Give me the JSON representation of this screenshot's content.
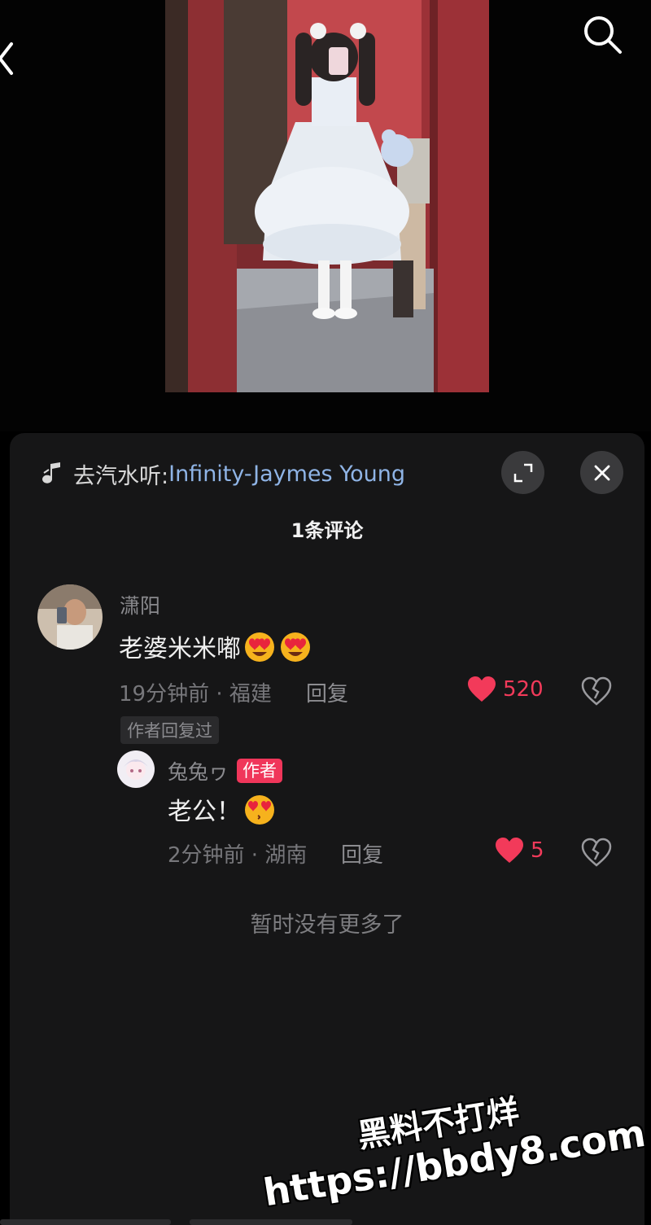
{
  "nav": {
    "back_icon": "chevron-left-icon",
    "search_icon": "search-icon"
  },
  "sheet": {
    "music": {
      "icon": "music-note-icon",
      "prefix": "去汽水听: ",
      "song": "Infinity-Jaymes Young"
    },
    "expand_icon": "expand-icon",
    "close_icon": "close-icon",
    "comment_count": "1条评论",
    "comments": [
      {
        "username": "潇阳",
        "text": "老婆米米嘟",
        "emojis": [
          "heart-eyes-emoji",
          "heart-eyes-emoji"
        ],
        "time_location": "19分钟前 · 福建",
        "reply_label": "回复",
        "likes": "520",
        "author_replied_tag": "作者回复过"
      }
    ],
    "replies": [
      {
        "username": "兔兔ヮ",
        "badge": "作者",
        "text": "老公！",
        "emojis": [
          "kiss-heart-emoji"
        ],
        "time_location": "2分钟前 · 湖南",
        "reply_label": "回复",
        "likes": "5"
      }
    ],
    "no_more": "暂时没有更多了"
  },
  "watermark": {
    "line1": "黑料不打烊",
    "line2": "https://bbdy8.com"
  },
  "colors": {
    "accent_like": "#f23a5a",
    "link_blue": "#8fb4e6",
    "sheet_bg": "#161617",
    "author_badge": "#f0365a"
  }
}
